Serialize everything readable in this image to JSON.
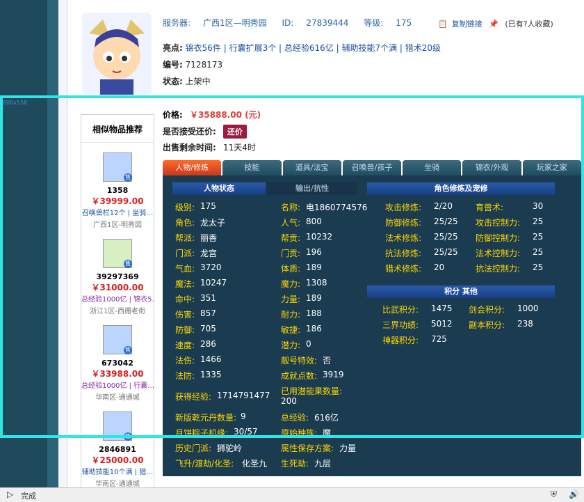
{
  "header": {
    "server_label": "服务器:",
    "server_value": "广西1区—明秀园",
    "id_label": "ID:",
    "id_value": "27839444",
    "level_label": "等级:",
    "level_value": "175",
    "copy_link": "复制链接",
    "collect_note": "(已有?人收藏)"
  },
  "details": {
    "highlight_label": "亮点:",
    "highlight_value": "锦衣56件 | 行囊扩展3个 | 总经验616亿 | 辅助技能7个满 | 猎术20级",
    "number_label": "编号:",
    "number_value": "7128173",
    "state_label": "状态:",
    "state_value": "上架中",
    "price_label": "价格:",
    "price_value": "￥35888.00 (元)",
    "offer_label": "是否接受还价:",
    "offer_btn": "还价",
    "time_label": "出售剩余时间:",
    "time_value": "11天4时"
  },
  "sidebar": {
    "title": "相似物品推荐",
    "items": [
      {
        "id": "1358",
        "price": "￥39999.00",
        "tag": "召唤兽栏12个 | 坐骑…",
        "loc": "广西1区-明秀园",
        "thumb_color": "#bcd5ff"
      },
      {
        "id": "39297369",
        "price": "￥31000.00",
        "tag": "总经验1000亿 | 锦衣5…",
        "loc": "浙江1区-西栅老街",
        "thumb_color": "#d8efc4"
      },
      {
        "id": "673042",
        "price": "￥33988.00",
        "tag": "总经验1000亿 | 行囊…",
        "loc": "华南区-通通城",
        "thumb_color": "#bcd5ff"
      },
      {
        "id": "2846891",
        "price": "￥25000.00",
        "tag": "辅助技能10个满 | 猎…",
        "loc": "华南区-通通城",
        "thumb_color": "#bcd5ff"
      }
    ]
  },
  "tabs": [
    "人物/修炼",
    "技能",
    "道具/法宝",
    "召唤兽/孩子",
    "坐骑",
    "锦衣/外观",
    "玩家之家"
  ],
  "panel": {
    "section_left_a": "人物状态",
    "section_left_b": "输出/抗性",
    "section_right": "角色修炼及宠修",
    "section_score": "积分 其他",
    "left_col1": [
      [
        "级别:",
        "175"
      ],
      [
        "角色:",
        "龙太子"
      ],
      [
        "帮派:",
        "丽香"
      ],
      [
        "门派:",
        "龙宫"
      ],
      [
        "气血:",
        "3720"
      ],
      [
        "魔法:",
        "10247"
      ],
      [
        "命中:",
        "351"
      ],
      [
        "伤害:",
        "857"
      ],
      [
        "防御:",
        "705"
      ],
      [
        "速度:",
        "286"
      ],
      [
        "法伤:",
        "1466"
      ],
      [
        "法防:",
        "1335"
      ]
    ],
    "left_col2": [
      [
        "名称:",
        "电1860774576"
      ],
      [
        "人气:",
        "800"
      ],
      [
        "帮贡:",
        "10232"
      ],
      [
        "门贡:",
        "196"
      ],
      [
        "体质:",
        "189"
      ],
      [
        "魔力:",
        "1308"
      ],
      [
        "力量:",
        "189"
      ],
      [
        "耐力:",
        "188"
      ],
      [
        "敏捷:",
        "186"
      ],
      [
        "潜力:",
        "0"
      ],
      [
        "靓号特效:",
        "否"
      ],
      [
        "成就点数:",
        "3919"
      ]
    ],
    "exp_label": "获得经验:",
    "exp_value": "1714791477",
    "used_label": "已用潜能果数量:",
    "used_value": "200",
    "new_label": "新版乾元丹数量:",
    "new_value": "9",
    "total_label": "总经验:",
    "total_value": "616亿",
    "moon_label": "月饼粽子机缘:",
    "moon_value": "30/57",
    "race_label": "原始种族:",
    "race_value": "魔",
    "history_label": "历史门派:",
    "history_value": "狮驼岭",
    "attr_label": "属性保存方案:",
    "attr_value": "力量",
    "fly_label": "飞升/渡劫/化圣:",
    "fly_value": "化圣九",
    "life_label": "生死劫:",
    "life_value": "九层",
    "xl": [
      [
        "攻击修炼:",
        "2/20",
        "育兽术:",
        "30"
      ],
      [
        "防御修炼:",
        "25/25",
        "攻击控制力:",
        "25"
      ],
      [
        "法术修炼:",
        "25/25",
        "防御控制力:",
        "25"
      ],
      [
        "抗法修炼:",
        "25/25",
        "法术控制力:",
        "25"
      ],
      [
        "猎术修炼:",
        "20",
        "抗法控制力:",
        "25"
      ]
    ],
    "score": [
      [
        "比武积分:",
        "1475",
        "剑会积分:",
        "1000"
      ],
      [
        "三界功绩:",
        "5012",
        "副本积分:",
        "238"
      ],
      [
        "神器积分:",
        "725",
        "",
        ""
      ]
    ]
  },
  "status": {
    "text": "完成"
  },
  "overlay": {
    "tag": "800x558"
  }
}
